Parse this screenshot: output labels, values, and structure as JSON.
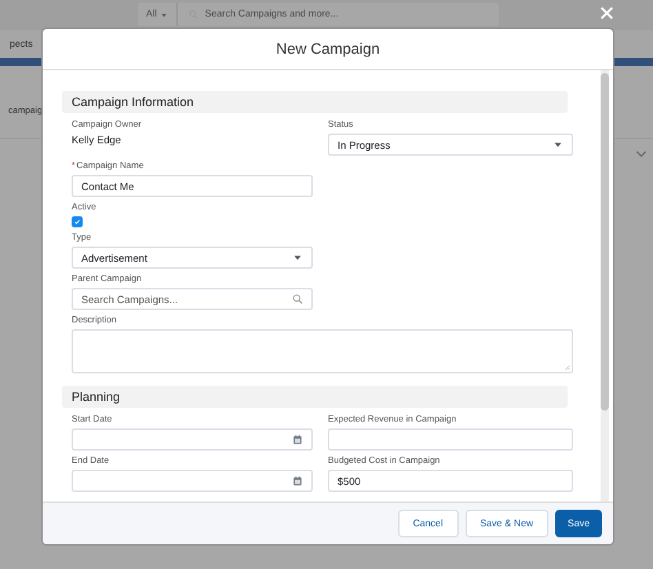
{
  "background": {
    "search_scope": "All",
    "search_placeholder": "Search Campaigns and more...",
    "tab": "pects",
    "row_text": "campaig"
  },
  "modal": {
    "title": "New Campaign",
    "sections": [
      {
        "title": "Campaign Information",
        "rows": [
          {
            "left": {
              "kind": "readonly",
              "label": "Campaign Owner",
              "value": "Kelly Edge"
            },
            "right": {
              "kind": "select",
              "label": "Status",
              "value": "In Progress"
            }
          },
          {
            "left": {
              "kind": "text",
              "label": "Campaign Name",
              "required_mark": "*",
              "value": "Contact Me"
            }
          },
          {
            "left": {
              "kind": "checkbox",
              "label": "Active",
              "checked": true
            }
          },
          {
            "left": {
              "kind": "select",
              "label": "Type",
              "value": "Advertisement"
            }
          },
          {
            "left": {
              "kind": "lookup",
              "label": "Parent Campaign",
              "placeholder": "Search Campaigns..."
            }
          },
          {
            "full": {
              "kind": "textarea",
              "label": "Description"
            }
          }
        ]
      },
      {
        "title": "Planning",
        "rows": [
          {
            "left": {
              "kind": "date",
              "label": "Start Date"
            },
            "right": {
              "kind": "text",
              "label": "Expected Revenue in Campaign"
            }
          },
          {
            "left": {
              "kind": "date",
              "label": "End Date"
            },
            "right": {
              "kind": "text",
              "label": "Budgeted Cost in Campaign",
              "value": "$500"
            }
          }
        ]
      }
    ],
    "buttons": [
      {
        "label": "Cancel",
        "kind": "neutral"
      },
      {
        "label": "Save & New",
        "kind": "neutral"
      },
      {
        "label": "Save",
        "kind": "brand"
      }
    ]
  }
}
